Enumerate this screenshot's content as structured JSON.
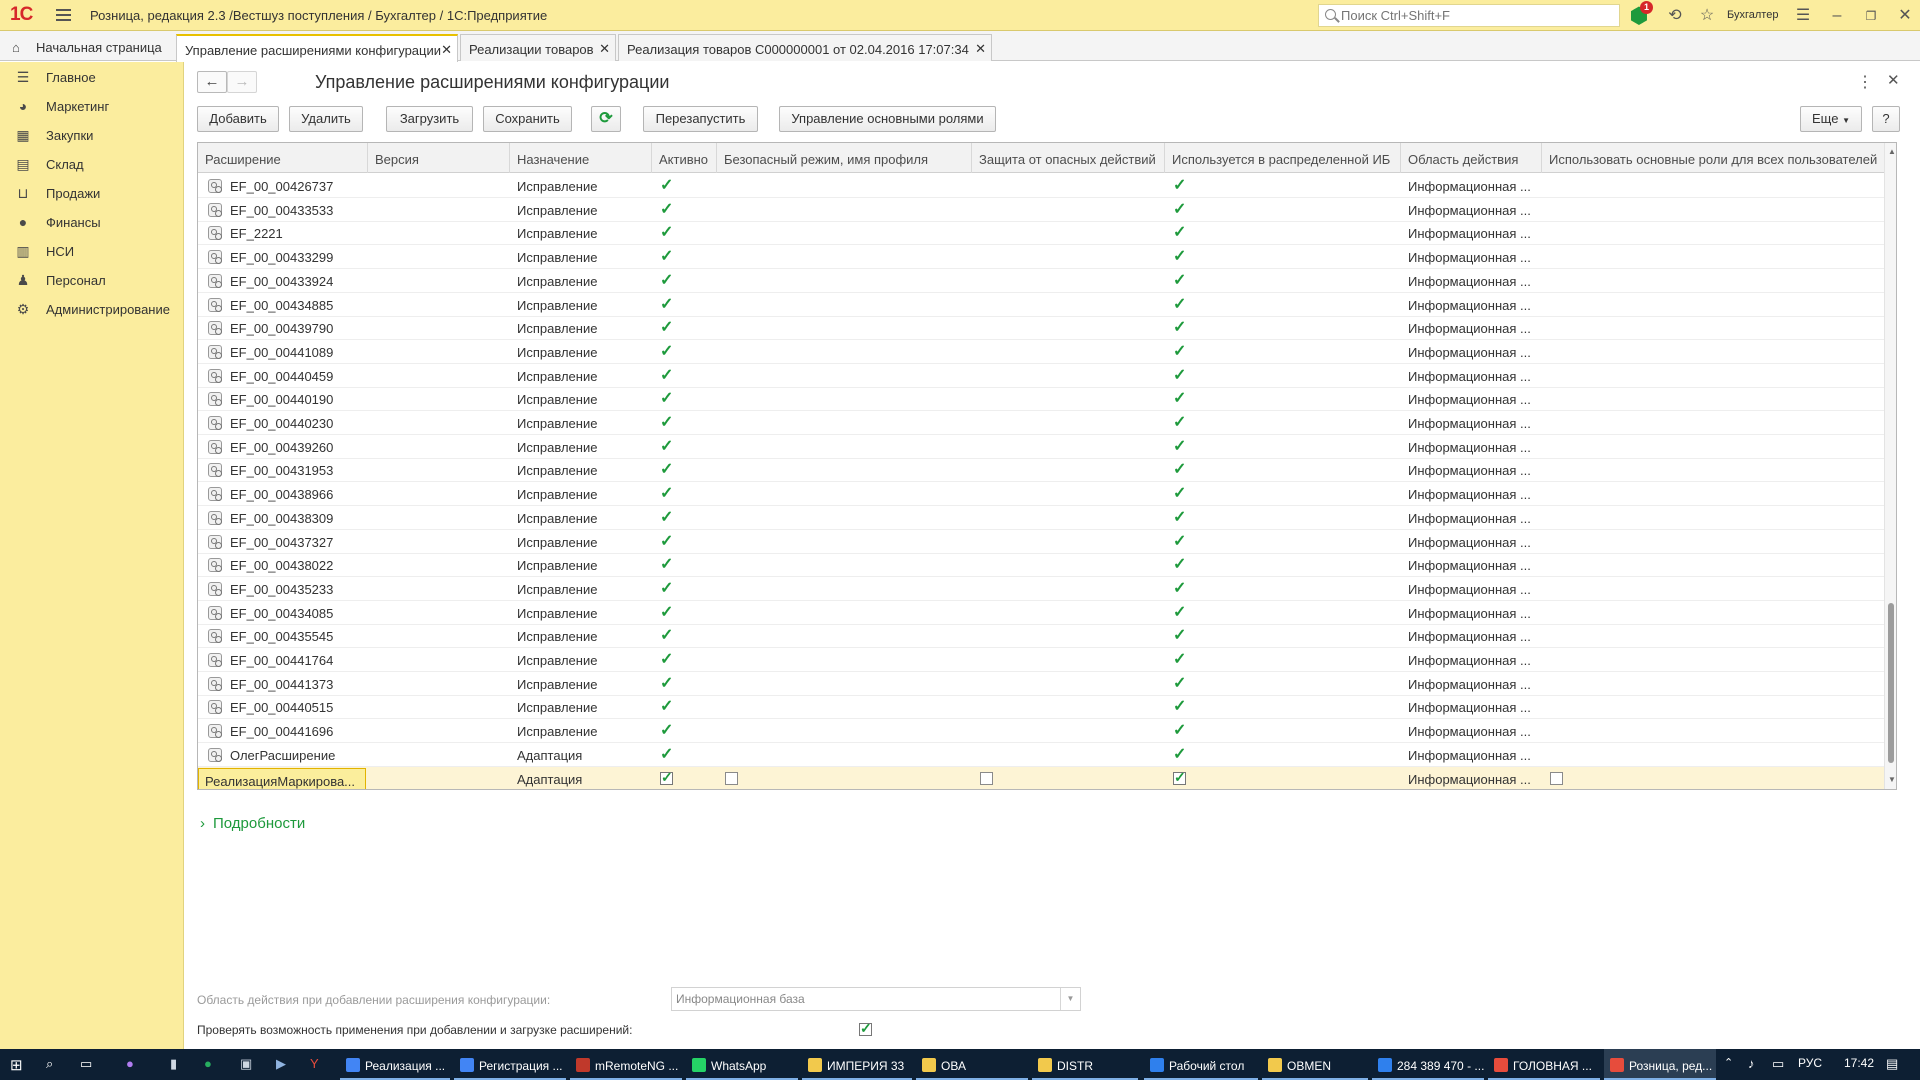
{
  "window": {
    "logo": "1С",
    "title": "Розница, редакция 2.3 /Вестшуз поступления / Бухгалтер / 1С:Предприятие",
    "search_placeholder": "Поиск Ctrl+Shift+F",
    "notifications_count": "1",
    "user": "Бухгалтер"
  },
  "tabs": {
    "home": "Начальная страница",
    "items": [
      {
        "label": "Управление расширениями конфигурации",
        "active": true
      },
      {
        "label": "Реализации товаров",
        "active": false
      },
      {
        "label": "Реализация товаров С000000001 от 02.04.2016 17:07:34",
        "active": false
      }
    ]
  },
  "sidebar": {
    "items": [
      {
        "label": "Главное",
        "icon": "menu-lines-icon"
      },
      {
        "label": "Маркетинг",
        "icon": "pie-chart-icon"
      },
      {
        "label": "Закупки",
        "icon": "cart-grid-icon"
      },
      {
        "label": "Склад",
        "icon": "warehouse-icon"
      },
      {
        "label": "Продажи",
        "icon": "basket-icon"
      },
      {
        "label": "Финансы",
        "icon": "coin-icon"
      },
      {
        "label": "НСИ",
        "icon": "books-icon"
      },
      {
        "label": "Персонал",
        "icon": "person-icon"
      },
      {
        "label": "Администрирование",
        "icon": "gear-icon"
      }
    ]
  },
  "form": {
    "title": "Управление расширениями конфигурации",
    "buttons": {
      "add": "Добавить",
      "delete": "Удалить",
      "load": "Загрузить",
      "save": "Сохранить",
      "restart": "Перезапустить",
      "roles": "Управление основными ролями",
      "more": "Еще",
      "help": "?"
    }
  },
  "table": {
    "columns": [
      "Расширение",
      "Версия",
      "Назначение",
      "Активно",
      "Безопасный режим, имя профиля",
      "Защита от опасных действий",
      "Используется в распределенной ИБ",
      "Область действия",
      "Использовать основные роли для всех пользователей"
    ],
    "rows": [
      {
        "name": "EF_00_00426737",
        "version": "",
        "purpose": "Исправление",
        "active": true,
        "safe_mode": false,
        "protection": false,
        "distributed": true,
        "scope": "Информационная ...",
        "use_roles": false
      },
      {
        "name": "EF_00_00433533",
        "version": "",
        "purpose": "Исправление",
        "active": true,
        "safe_mode": false,
        "protection": false,
        "distributed": true,
        "scope": "Информационная ...",
        "use_roles": false
      },
      {
        "name": "EF_2221",
        "version": "",
        "purpose": "Исправление",
        "active": true,
        "safe_mode": false,
        "protection": false,
        "distributed": true,
        "scope": "Информационная ...",
        "use_roles": false
      },
      {
        "name": "EF_00_00433299",
        "version": "",
        "purpose": "Исправление",
        "active": true,
        "safe_mode": false,
        "protection": false,
        "distributed": true,
        "scope": "Информационная ...",
        "use_roles": false
      },
      {
        "name": "EF_00_00433924",
        "version": "",
        "purpose": "Исправление",
        "active": true,
        "safe_mode": false,
        "protection": false,
        "distributed": true,
        "scope": "Информационная ...",
        "use_roles": false
      },
      {
        "name": "EF_00_00434885",
        "version": "",
        "purpose": "Исправление",
        "active": true,
        "safe_mode": false,
        "protection": false,
        "distributed": true,
        "scope": "Информационная ...",
        "use_roles": false
      },
      {
        "name": "EF_00_00439790",
        "version": "",
        "purpose": "Исправление",
        "active": true,
        "safe_mode": false,
        "protection": false,
        "distributed": true,
        "scope": "Информационная ...",
        "use_roles": false
      },
      {
        "name": "EF_00_00441089",
        "version": "",
        "purpose": "Исправление",
        "active": true,
        "safe_mode": false,
        "protection": false,
        "distributed": true,
        "scope": "Информационная ...",
        "use_roles": false
      },
      {
        "name": "EF_00_00440459",
        "version": "",
        "purpose": "Исправление",
        "active": true,
        "safe_mode": false,
        "protection": false,
        "distributed": true,
        "scope": "Информационная ...",
        "use_roles": false
      },
      {
        "name": "EF_00_00440190",
        "version": "",
        "purpose": "Исправление",
        "active": true,
        "safe_mode": false,
        "protection": false,
        "distributed": true,
        "scope": "Информационная ...",
        "use_roles": false
      },
      {
        "name": "EF_00_00440230",
        "version": "",
        "purpose": "Исправление",
        "active": true,
        "safe_mode": false,
        "protection": false,
        "distributed": true,
        "scope": "Информационная ...",
        "use_roles": false
      },
      {
        "name": "EF_00_00439260",
        "version": "",
        "purpose": "Исправление",
        "active": true,
        "safe_mode": false,
        "protection": false,
        "distributed": true,
        "scope": "Информационная ...",
        "use_roles": false
      },
      {
        "name": "EF_00_00431953",
        "version": "",
        "purpose": "Исправление",
        "active": true,
        "safe_mode": false,
        "protection": false,
        "distributed": true,
        "scope": "Информационная ...",
        "use_roles": false
      },
      {
        "name": "EF_00_00438966",
        "version": "",
        "purpose": "Исправление",
        "active": true,
        "safe_mode": false,
        "protection": false,
        "distributed": true,
        "scope": "Информационная ...",
        "use_roles": false
      },
      {
        "name": "EF_00_00438309",
        "version": "",
        "purpose": "Исправление",
        "active": true,
        "safe_mode": false,
        "protection": false,
        "distributed": true,
        "scope": "Информационная ...",
        "use_roles": false
      },
      {
        "name": "EF_00_00437327",
        "version": "",
        "purpose": "Исправление",
        "active": true,
        "safe_mode": false,
        "protection": false,
        "distributed": true,
        "scope": "Информационная ...",
        "use_roles": false
      },
      {
        "name": "EF_00_00438022",
        "version": "",
        "purpose": "Исправление",
        "active": true,
        "safe_mode": false,
        "protection": false,
        "distributed": true,
        "scope": "Информационная ...",
        "use_roles": false
      },
      {
        "name": "EF_00_00435233",
        "version": "",
        "purpose": "Исправление",
        "active": true,
        "safe_mode": false,
        "protection": false,
        "distributed": true,
        "scope": "Информационная ...",
        "use_roles": false
      },
      {
        "name": "EF_00_00434085",
        "version": "",
        "purpose": "Исправление",
        "active": true,
        "safe_mode": false,
        "protection": false,
        "distributed": true,
        "scope": "Информационная ...",
        "use_roles": false
      },
      {
        "name": "EF_00_00435545",
        "version": "",
        "purpose": "Исправление",
        "active": true,
        "safe_mode": false,
        "protection": false,
        "distributed": true,
        "scope": "Информационная ...",
        "use_roles": false
      },
      {
        "name": "EF_00_00441764",
        "version": "",
        "purpose": "Исправление",
        "active": true,
        "safe_mode": false,
        "protection": false,
        "distributed": true,
        "scope": "Информационная ...",
        "use_roles": false
      },
      {
        "name": "EF_00_00441373",
        "version": "",
        "purpose": "Исправление",
        "active": true,
        "safe_mode": false,
        "protection": false,
        "distributed": true,
        "scope": "Информационная ...",
        "use_roles": false
      },
      {
        "name": "EF_00_00440515",
        "version": "",
        "purpose": "Исправление",
        "active": true,
        "safe_mode": false,
        "protection": false,
        "distributed": true,
        "scope": "Информационная ...",
        "use_roles": false
      },
      {
        "name": "EF_00_00441696",
        "version": "",
        "purpose": "Исправление",
        "active": true,
        "safe_mode": false,
        "protection": false,
        "distributed": true,
        "scope": "Информационная ...",
        "use_roles": false
      },
      {
        "name": "ОлегРасширение",
        "version": "",
        "purpose": "Адаптация",
        "active": true,
        "safe_mode": false,
        "protection": false,
        "distributed": true,
        "scope": "Информационная ...",
        "use_roles": false
      }
    ],
    "selected_row": {
      "name": "РеализацияМаркирова...",
      "version": "",
      "purpose": "Адаптация",
      "active": true,
      "safe_mode": false,
      "protection": false,
      "distributed": true,
      "scope": "Информационная ...",
      "use_roles": false
    }
  },
  "details": {
    "link": "Подробности",
    "area_label": "Область действия при добавлении расширения конфигурации:",
    "area_value": "Информационная база",
    "verify_label": "Проверять возможность применения при добавлении и загрузке расширений:",
    "verify_checked": true
  },
  "taskbar": {
    "apps": [
      {
        "label": "Реализация ...",
        "color": "#4285f4"
      },
      {
        "label": "Регистрация ...",
        "color": "#4285f4"
      },
      {
        "label": "mRemoteNG ...",
        "color": "#c0392b"
      },
      {
        "label": "WhatsApp",
        "color": "#25d366"
      },
      {
        "label": "ИМПЕРИЯ 33",
        "color": "#f2c94c"
      },
      {
        "label": "ОВА",
        "color": "#f2c94c"
      },
      {
        "label": "DISTR",
        "color": "#f2c94c"
      },
      {
        "label": "Рабочий стол",
        "color": "#2f80ed"
      },
      {
        "label": "OBMEN",
        "color": "#f2c94c"
      },
      {
        "label": "284 389 470 - ...",
        "color": "#2f80ed"
      },
      {
        "label": "ГОЛОВНАЯ ...",
        "color": "#e74c3c"
      },
      {
        "label": "Розница, ред...",
        "color": "#e74c3c"
      }
    ],
    "lang": "РУС",
    "time": "17:42"
  },
  "colors": {
    "accent_yellow": "#fbed9e",
    "check_green": "#1e9a3c",
    "tab_active_border": "#e8c100",
    "selected_row": "#fdf4d5"
  }
}
